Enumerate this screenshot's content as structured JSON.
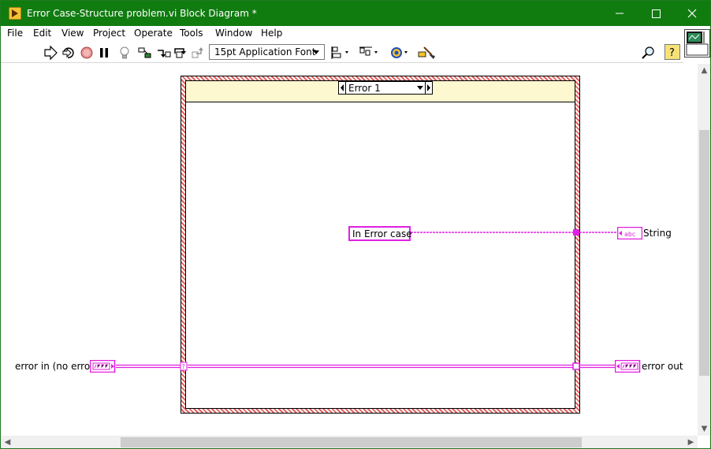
{
  "window": {
    "title": "Error Case-Structure problem.vi Block Diagram *",
    "accent_color": "#107c10"
  },
  "menubar": {
    "items": [
      {
        "label": "File"
      },
      {
        "label": "Edit"
      },
      {
        "label": "View"
      },
      {
        "label": "Project"
      },
      {
        "label": "Operate"
      },
      {
        "label": "Tools"
      },
      {
        "label": "Window"
      },
      {
        "label": "Help"
      }
    ]
  },
  "toolbar": {
    "font_select_value": "15pt Application Font",
    "icons": [
      "run-arrow-icon",
      "run-continuously-icon",
      "abort-icon",
      "pause-icon",
      "highlight-execution-icon",
      "retain-wire-values-icon",
      "step-into-icon",
      "step-over-icon",
      "step-out-icon",
      "align-objects-icon",
      "distribute-objects-icon",
      "reorder-icon",
      "cleanup-diagram-icon",
      "search-icon",
      "context-help-icon"
    ]
  },
  "diagram": {
    "case_selector_value": "Error 1",
    "string_constant": "In Error case",
    "indicators": {
      "string_label": "String",
      "error_out_label": "error out"
    },
    "controls": {
      "error_in_label": "error in (no error)"
    },
    "wire_colors": {
      "string": "#e020e0",
      "cluster": "#e020e0"
    }
  }
}
